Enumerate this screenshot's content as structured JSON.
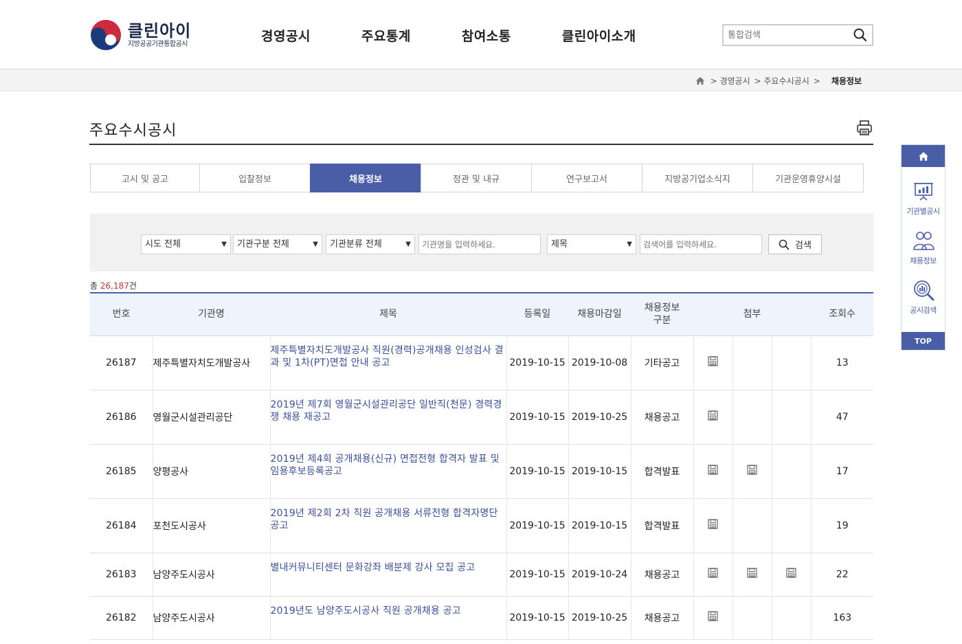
{
  "header": {
    "logo_name": "클린아이",
    "logo_sub": "지방공공기관통합공시",
    "nav": [
      "경영공시",
      "주요통계",
      "참여소통",
      "클린아이소개"
    ],
    "search_placeholder": "통합검색"
  },
  "breadcrumb": {
    "items": [
      "> 경영공시",
      "> 주요수시공시",
      ">"
    ],
    "current": "채용정보"
  },
  "page": {
    "title": "주요수시공시"
  },
  "tabs": [
    {
      "label": "고시 및 공고",
      "active": false
    },
    {
      "label": "입찰정보",
      "active": false
    },
    {
      "label": "채용정보",
      "active": true
    },
    {
      "label": "정관 및 내규",
      "active": false
    },
    {
      "label": "연구보고서",
      "active": false
    },
    {
      "label": "지방공기업소식지",
      "active": false
    },
    {
      "label": "기관운영휴양시설",
      "active": false
    }
  ],
  "search": {
    "region": "시도 전체",
    "org_type": "기관구분 전체",
    "org_class": "기관분류 전체",
    "org_name_placeholder": "기관명을 입력하세요.",
    "field": "제목",
    "keyword_placeholder": "검색어를 입력하세요.",
    "button": "검색"
  },
  "total": {
    "prefix": "총 ",
    "count": "26,187",
    "suffix": "건"
  },
  "table": {
    "headers": {
      "no": "번호",
      "org": "기관명",
      "title": "제목",
      "reg": "등록일",
      "deadline": "채용마감일",
      "kind_line1": "채용정보",
      "kind_line2": "구분",
      "attach": "첨부",
      "views": "조회수"
    },
    "rows": [
      {
        "no": "26187",
        "org": "제주특별자치도개발공사",
        "title": "제주특별자치도개발공사 직원(경력)공개채용 인성검사 결과 및 1차(PT)면접 안내 공고",
        "reg": "2019-10-15",
        "deadline": "2019-10-08",
        "kind": "기타공고",
        "files": [
          true,
          false,
          false
        ],
        "views": "13"
      },
      {
        "no": "26186",
        "org": "영월군시설관리공단",
        "title": "2019년 제7회 영월군시설관리공단 일반직(천문) 경력경쟁 채용 재공고",
        "reg": "2019-10-15",
        "deadline": "2019-10-25",
        "kind": "채용공고",
        "files": [
          true,
          false,
          false
        ],
        "views": "47"
      },
      {
        "no": "26185",
        "org": "양평공사",
        "title": "2019년 제4회 공개채용(신규) 면접전형 합격자 발표 및 임용후보등록공고",
        "reg": "2019-10-15",
        "deadline": "2019-10-15",
        "kind": "합격발표",
        "files": [
          true,
          true,
          false
        ],
        "views": "17"
      },
      {
        "no": "26184",
        "org": "포천도시공사",
        "title": "2019년 제2회 2차 직원 공개채용 서류전형 합격자명단 공고",
        "reg": "2019-10-15",
        "deadline": "2019-10-15",
        "kind": "합격발표",
        "files": [
          true,
          false,
          false
        ],
        "views": "19"
      },
      {
        "no": "26183",
        "org": "남양주도시공사",
        "title": "별내커뮤니티센터 문화강좌 배분제 강사 모집 공고",
        "reg": "2019-10-15",
        "deadline": "2019-10-24",
        "kind": "채용공고",
        "files": [
          true,
          true,
          true
        ],
        "views": "22"
      },
      {
        "no": "26182",
        "org": "남양주도시공사",
        "title": "2019년도 남양주도시공사 직원 공개채용 공고",
        "reg": "2019-10-15",
        "deadline": "2019-10-25",
        "kind": "채용공고",
        "files": [
          true,
          false,
          false
        ],
        "views": "163"
      }
    ]
  },
  "quick": {
    "items": [
      "기관별공시",
      "채용정보",
      "공시검색"
    ],
    "top": "TOP"
  },
  "colors": {
    "accent": "#4a5ea7",
    "count_red": "#c0392b",
    "link_blue": "#3a4f9a"
  }
}
